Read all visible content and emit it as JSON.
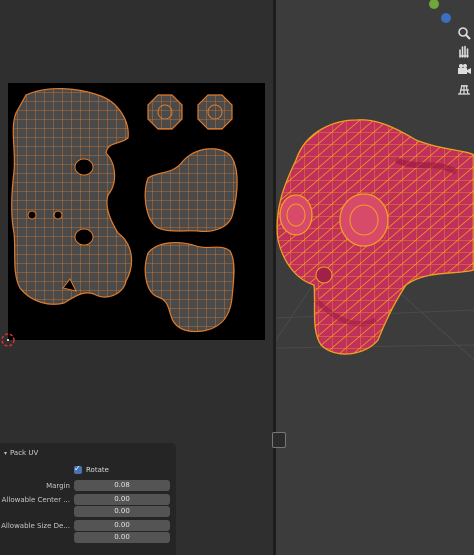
{
  "panel": {
    "title": "Pack UV",
    "rotate_label": "Rotate",
    "rotate_checked": true,
    "margin_label": "Margin",
    "margin_value": "0.08",
    "center_label": "Allowable Center ...",
    "center_value_1": "0.00",
    "center_value_2": "0.00",
    "size_label": "Allowable Size De...",
    "size_value_1": "0.00",
    "size_value_2": "0.00"
  },
  "colors": {
    "uv_edge": "#e07b2a",
    "uv_face": "#4a4a4a",
    "mesh_face": "#c0305a",
    "mesh_edge": "#f0a020"
  },
  "icons": [
    "gizmo-circle-icon",
    "gizmo-axis-icon",
    "zoom-icon",
    "hand-pan-icon",
    "camera-icon",
    "grid-icon",
    "uv-cursor-icon"
  ]
}
